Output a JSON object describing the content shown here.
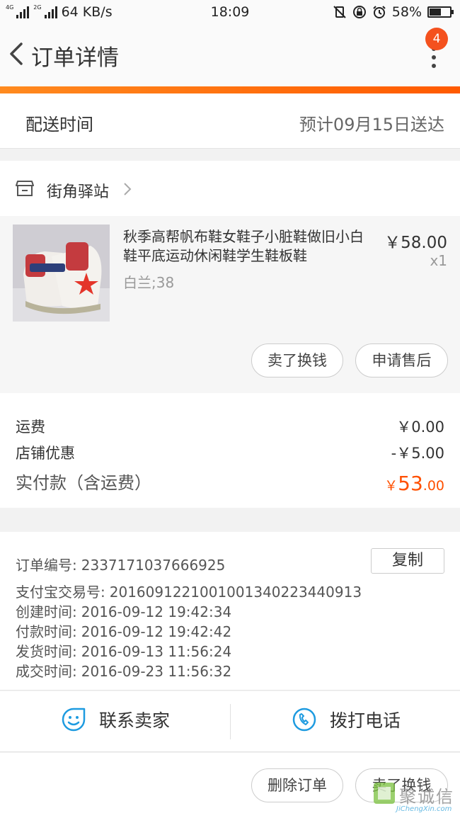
{
  "status_bar": {
    "net_4g": "4G",
    "net_2g": "2G",
    "speed": "64 KB/s",
    "time": "18:09",
    "battery": "58%"
  },
  "header": {
    "title": "订单详情",
    "badge_count": "4"
  },
  "delivery": {
    "label": "配送时间",
    "value": "预计09月15日送达"
  },
  "shop": {
    "name": "街角驿站"
  },
  "product": {
    "name": "秋季高帮帆布鞋女鞋子小脏鞋做旧小白鞋平底运动休闲鞋学生鞋板鞋",
    "sku": "白兰;38",
    "price": "￥58.00",
    "quantity": "x1",
    "buttons": [
      "卖了换钱",
      "申请售后"
    ]
  },
  "fees": {
    "shipping_label": "运费",
    "shipping_value": "￥0.00",
    "discount_label": "店铺优惠",
    "discount_value": "-￥5.00",
    "total_label": "实付款（含运费）",
    "total_currency": "￥",
    "total_int": "53",
    "total_dec": ".00"
  },
  "info": {
    "order_no_label": "订单编号:",
    "order_no": "2337171037666925",
    "copy_button": "复制",
    "alipay_label": "支付宝交易号:",
    "alipay_no": "2016091221001001340223440913",
    "created_label": "创建时间:",
    "created": "2016-09-12 19:42:34",
    "paid_label": "付款时间:",
    "paid": "2016-09-12 19:42:42",
    "shipped_label": "发货时间:",
    "shipped": "2016-09-13 11:56:24",
    "done_label": "成交时间:",
    "done": "2016-09-23 11:56:32"
  },
  "actions": {
    "contact_seller": "联系卖家",
    "call": "拨打电话"
  },
  "footer": {
    "buttons": [
      "删除订单",
      "卖了换钱"
    ]
  },
  "watermark": {
    "text": "聚诚信",
    "sub": "JiChengXin.com"
  },
  "colors": {
    "accent": "#ff5000",
    "badge": "#f4511e",
    "icon_blue": "#1e9be0"
  }
}
